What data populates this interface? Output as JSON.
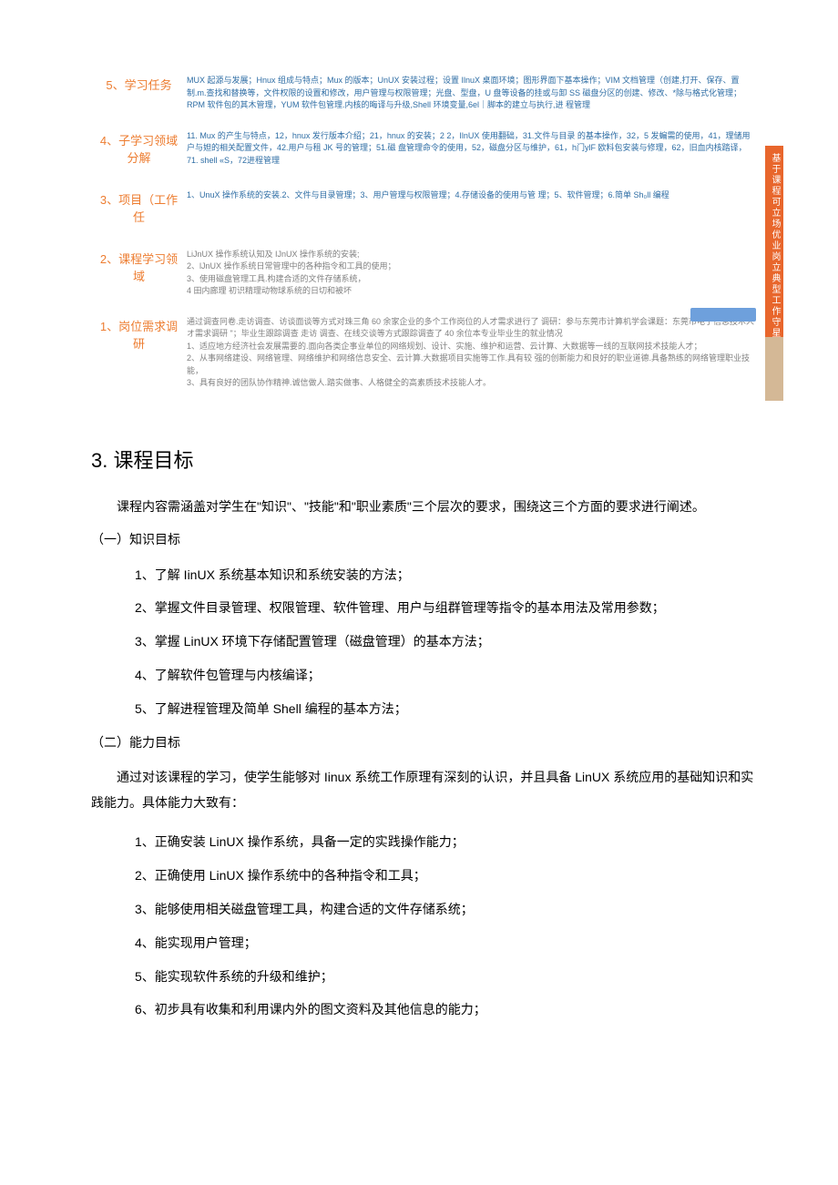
{
  "diagram": {
    "rows": [
      {
        "num": "5",
        "label": "学习任务",
        "content": "MUX 起源与发展；Hnux 组成与特点；Mux 的版本；UnUX 安装过程；设置 IlnuX 桌面环境；图形界面下基本操作；VIM 文档管理（创建,打开、保存、置制.m.查找和替换等，文件权限的设置和修改，用户管理与权限管理；光盘、型盘，U 盘等设备的挂或与卸 SS 磁盘分区的创建、修改、*除与格式化管理；RPM 软件包的其木管理，YUM 软件包管理.内核的晦译与升级,Shell 环境变量,6el｜脚本的建立与执行,进 程管理"
      },
      {
        "num": "4",
        "label": "子学习领域分解",
        "content": "11. Mux 的产生与特点，12，hnux 发行版本介绍；21，hnux 的安装；2 2，IlnUX 使用翻础，31.文件与目录 的基本操作，32，5 发蝙需的使用，41，理储用户与妲的相关配置文件，42.用户与租 JK 号的管理；51.磁 盘管理命令的使用，52，磁盘分区与维护，61，h门ylF 欧料包安装与修理，62，旧血内核踏译，71. shell «S，72进程管理"
      },
      {
        "num": "3",
        "label": "项目（工作任",
        "content": "1、UnuX 操作系统的安装.2、文件与目录管理；3、用户管理与权限管理；4.存储设备的使用与管 理；5、软件管理；6.简单 Sh₀ll 编程"
      },
      {
        "num": "2",
        "label": "课程学习领域",
        "content": "LiJnUX 操作系统认知及 IJnUX 操作系统的安装;\n2、lJnUX 操作系统日常管理中的各种指令和工具的使用；\n3、使用磁盘管理工具.构建合适的文件存储系统，\n4 田内廊理 初识精理动物球系统的日切和被坏"
      },
      {
        "num": "1",
        "label": "岗位需求调研",
        "content": "通过调查冋卷.走访调查、访谈面谈等方式对珠三角 60 余家企业的多个工作岗位的人才需求进行了 调研：参与东莞市计算机学会课题：东莞市电子信息技术人オ需求调研 \"；毕业生跟踪调查 走访 调查、在线交谈等方式跟踪调查了 40 余位本专业毕业生的就业情况\n1、适应地方经济社会发展需要的.面向各类企事业单位的网络规划、设计、实施、维护和运营、云计算、大数据等一线的互联网技术技能人才；\n2、从事网络建设、网络管理、网络维护和网络信息安全、云计算.大数据项目实施等工作.具有较 强的创新能力和良好的职业道德.具备熟练的网络管理职业技能，\n3、具有良好的团队协作精神.诚信做人.踏实做事、人格健全的高素质技术技能人才。"
      }
    ],
    "sideTab": "基于课程可立场优业岗立典型工作守星"
  },
  "title3": "3. 课程目标",
  "intro": "课程内容需涵盖对学生在\"知识\"、\"技能\"和\"职业素质\"三个层次的要求，围绕这三个方面的要求进行阐述。",
  "subA": "（一）知识目标",
  "knowledgeItems": [
    "1、了解 IinUX 系统基本知识和系统安装的方法；",
    "2、掌握文件目录管理、权限管理、软件管理、用户与组群管理等指令的基本用法及常用参数；",
    "3、掌握 LinUX 环境下存储配置管理（磁盘管理）的基本方法；",
    "4、了解软件包管理与内核编译；",
    "5、了解进程管理及简单 Shell 编程的基本方法；"
  ],
  "subB": "（二）能力目标",
  "paraB": "通过对该课程的学习，使学生能够对 Iinux 系统工作原理有深刻的认识，并且具备 LinUX 系统应用的基础知识和实践能力。具体能力大致有：",
  "abilityItems": [
    "1、正确安装 LinUX 操作系统，具备一定的实践操作能力；",
    "2、正确使用 LinUX 操作系统中的各种指令和工具；",
    "3、能够使用相关磁盘管理工具，构建合适的文件存储系统；",
    "4、能实现用户管理；",
    "5、能实现软件系统的升级和维护；",
    "6、初步具有收集和利用课内外的图文资料及其他信息的能力；"
  ]
}
